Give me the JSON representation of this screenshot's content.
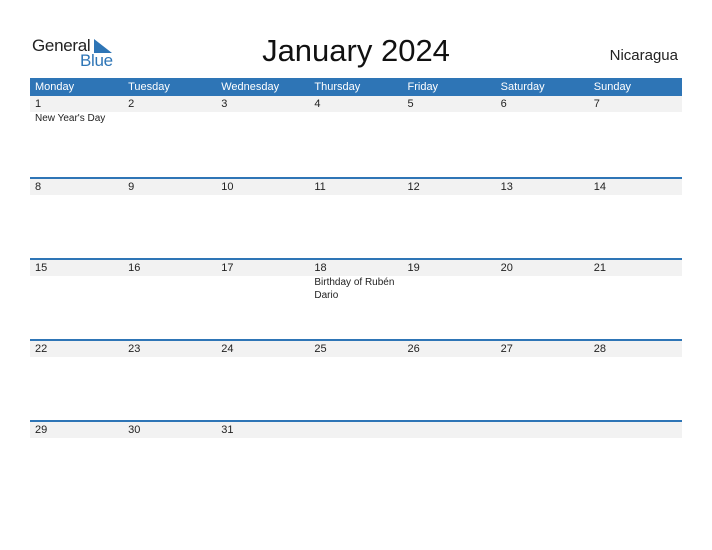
{
  "logo": {
    "line1": "General",
    "line2": "Blue"
  },
  "title": "January 2024",
  "country": "Nicaragua",
  "colors": {
    "accent": "#2e75b6",
    "date_strip": "#f2f2f2"
  },
  "weekdays": [
    "Monday",
    "Tuesday",
    "Wednesday",
    "Thursday",
    "Friday",
    "Saturday",
    "Sunday"
  ],
  "weeks": [
    [
      {
        "day": "1",
        "event": "New Year's Day"
      },
      {
        "day": "2",
        "event": ""
      },
      {
        "day": "3",
        "event": ""
      },
      {
        "day": "4",
        "event": ""
      },
      {
        "day": "5",
        "event": ""
      },
      {
        "day": "6",
        "event": ""
      },
      {
        "day": "7",
        "event": ""
      }
    ],
    [
      {
        "day": "8",
        "event": ""
      },
      {
        "day": "9",
        "event": ""
      },
      {
        "day": "10",
        "event": ""
      },
      {
        "day": "11",
        "event": ""
      },
      {
        "day": "12",
        "event": ""
      },
      {
        "day": "13",
        "event": ""
      },
      {
        "day": "14",
        "event": ""
      }
    ],
    [
      {
        "day": "15",
        "event": ""
      },
      {
        "day": "16",
        "event": ""
      },
      {
        "day": "17",
        "event": ""
      },
      {
        "day": "18",
        "event": "Birthday of Rubén Dario"
      },
      {
        "day": "19",
        "event": ""
      },
      {
        "day": "20",
        "event": ""
      },
      {
        "day": "21",
        "event": ""
      }
    ],
    [
      {
        "day": "22",
        "event": ""
      },
      {
        "day": "23",
        "event": ""
      },
      {
        "day": "24",
        "event": ""
      },
      {
        "day": "25",
        "event": ""
      },
      {
        "day": "26",
        "event": ""
      },
      {
        "day": "27",
        "event": ""
      },
      {
        "day": "28",
        "event": ""
      }
    ],
    [
      {
        "day": "29",
        "event": ""
      },
      {
        "day": "30",
        "event": ""
      },
      {
        "day": "31",
        "event": ""
      },
      {
        "day": "",
        "event": ""
      },
      {
        "day": "",
        "event": ""
      },
      {
        "day": "",
        "event": ""
      },
      {
        "day": "",
        "event": ""
      }
    ]
  ]
}
